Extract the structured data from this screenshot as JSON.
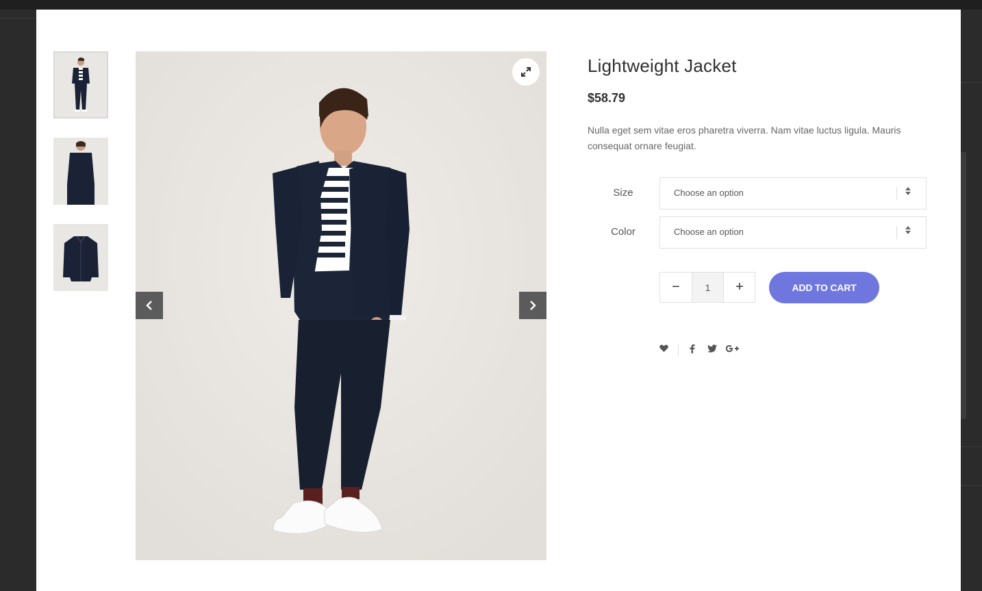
{
  "product": {
    "title": "Lightweight Jacket",
    "price": "$58.79",
    "description": "Nulla eget sem vitae eros pharetra viverra. Nam vitae luctus ligula. Mauris consequat ornare feugiat."
  },
  "options": [
    {
      "label": "Size",
      "value": "Choose an option"
    },
    {
      "label": "Color",
      "value": "Choose an option"
    }
  ],
  "quantity": {
    "value": "1",
    "minus": "−",
    "plus": "+"
  },
  "add_to_cart_label": "ADD TO CART",
  "colors": {
    "accent": "#6f77df",
    "text": "#2f2f2f",
    "nav_arrow_bg": "#5b5b5b"
  },
  "gallery": {
    "thumbnails": [
      "front-view",
      "back-view",
      "flat-jacket"
    ],
    "active_index": 0
  },
  "icons": {
    "zoom": "expand-icon",
    "prev": "chevron-left-icon",
    "next": "chevron-right-icon",
    "wishlist": "heart-icon",
    "social": [
      "facebook-icon",
      "twitter-icon",
      "google-plus-icon"
    ]
  }
}
